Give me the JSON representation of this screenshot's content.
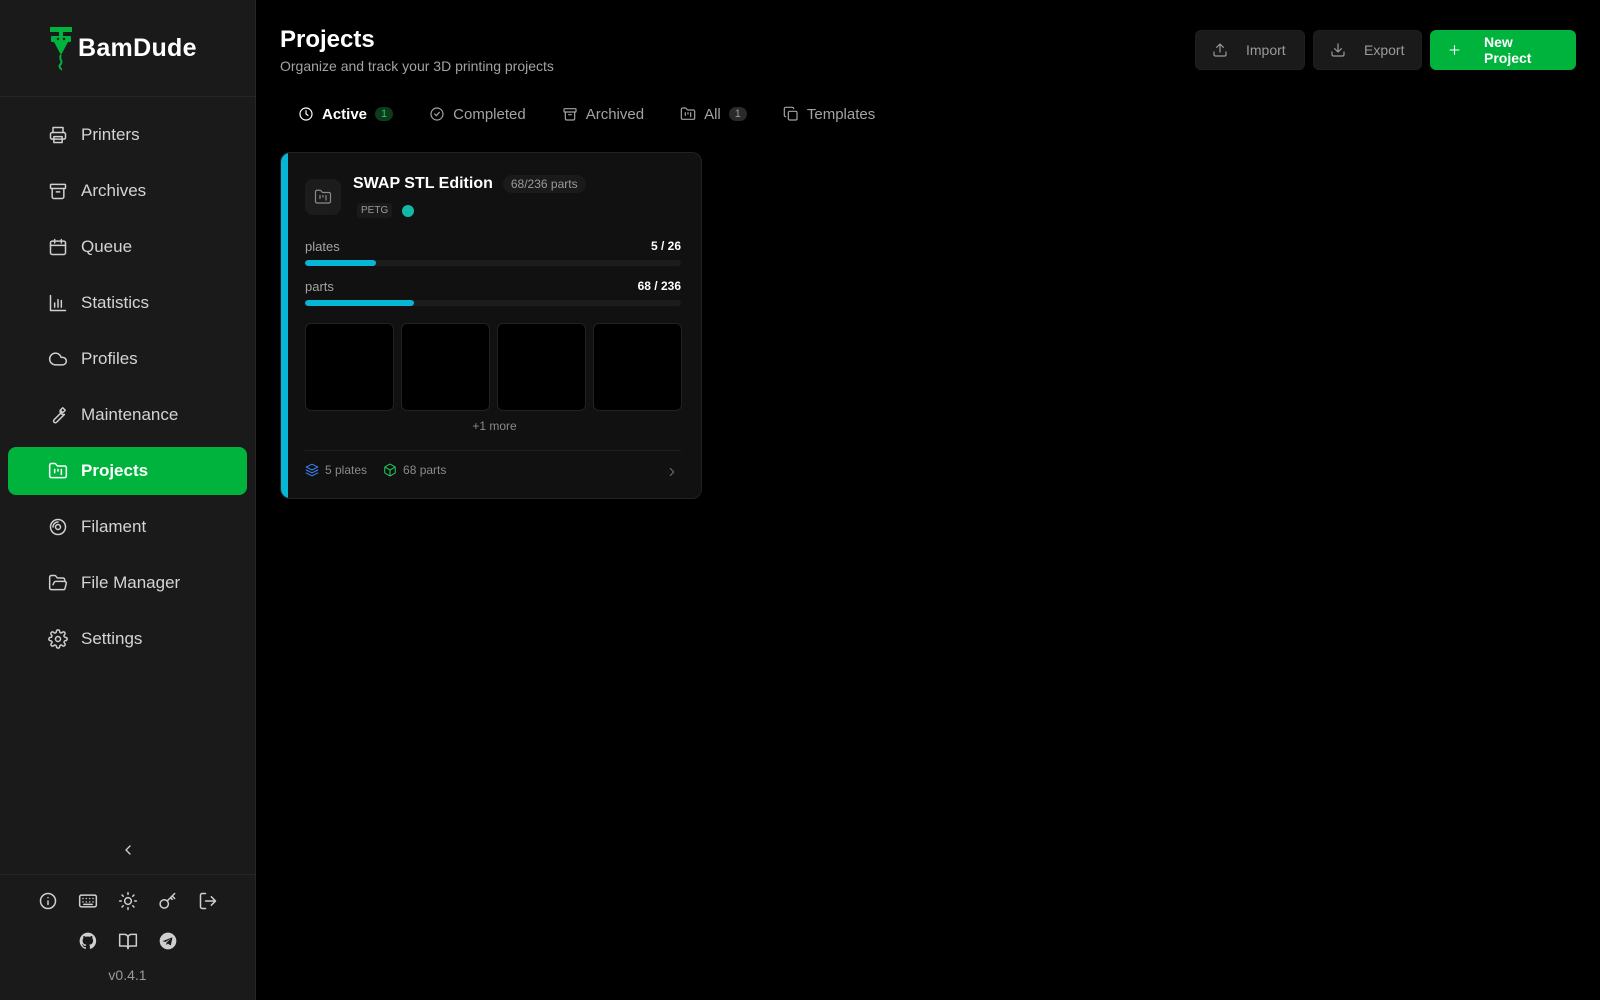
{
  "brand": {
    "name": "BamDude",
    "accent": "#00b33c"
  },
  "sidebar": {
    "items": [
      {
        "label": "Printers",
        "icon": "printer-icon"
      },
      {
        "label": "Archives",
        "icon": "archive-icon"
      },
      {
        "label": "Queue",
        "icon": "calendar-icon"
      },
      {
        "label": "Statistics",
        "icon": "bar-chart-icon"
      },
      {
        "label": "Profiles",
        "icon": "cloud-icon"
      },
      {
        "label": "Maintenance",
        "icon": "wrench-icon"
      },
      {
        "label": "Projects",
        "icon": "folder-kanban-icon",
        "active": true
      },
      {
        "label": "Filament",
        "icon": "disc-icon"
      },
      {
        "label": "File Manager",
        "icon": "folder-open-icon"
      },
      {
        "label": "Settings",
        "icon": "gear-icon"
      }
    ],
    "footer_icons_row1": [
      "info-icon",
      "keyboard-icon",
      "sun-icon",
      "key-icon",
      "logout-icon"
    ],
    "footer_icons_row2": [
      "github-icon",
      "book-icon",
      "telegram-icon"
    ],
    "version": "v0.4.1"
  },
  "header": {
    "title": "Projects",
    "subtitle": "Organize and track your 3D printing projects",
    "import_label": "Import",
    "export_label": "Export",
    "new_label": "New Project"
  },
  "tabs": [
    {
      "label": "Active",
      "count": "1",
      "icon": "clock-icon",
      "active": true
    },
    {
      "label": "Completed",
      "icon": "check-circle-icon"
    },
    {
      "label": "Archived",
      "icon": "archive-icon"
    },
    {
      "label": "All",
      "count": "1",
      "icon": "folder-kanban-icon"
    },
    {
      "label": "Templates",
      "icon": "copy-icon"
    }
  ],
  "project": {
    "title": "SWAP STL Edition",
    "parts_badge": "68/236 parts",
    "material": "PETG",
    "color": "#14b8a6",
    "accent": "#06b6d4",
    "plates_label": "plates",
    "plates_value": "5 / 26",
    "plates_progress": 0.19,
    "parts_label": "parts",
    "parts_value": "68 / 236",
    "parts_progress": 0.29,
    "more_label": "+1 more",
    "footer_plates": "5 plates",
    "footer_parts": "68 parts"
  }
}
